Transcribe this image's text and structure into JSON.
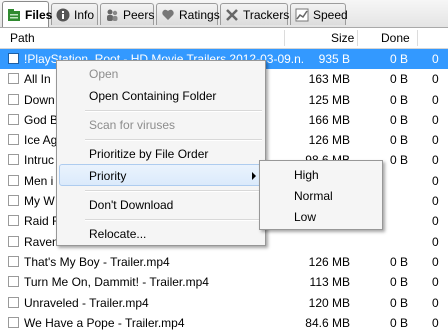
{
  "tabs": [
    {
      "label": "Files",
      "icon": "files-icon",
      "active": true
    },
    {
      "label": "Info",
      "icon": "info-icon"
    },
    {
      "label": "Peers",
      "icon": "peers-icon"
    },
    {
      "label": "Ratings",
      "icon": "ratings-icon"
    },
    {
      "label": "Trackers",
      "icon": "trackers-icon"
    },
    {
      "label": "Speed",
      "icon": "speed-icon"
    }
  ],
  "columns": {
    "path": "Path",
    "size": "Size",
    "done": "Done"
  },
  "rows": [
    {
      "path": "!PlayStation_Root - HD Movie Trailers 2012-03-09.n...",
      "size": "935 B",
      "done": "0 B",
      "extra": "0",
      "selected": true
    },
    {
      "path": "All In",
      "size": "163 MB",
      "done": "0 B",
      "extra": "0"
    },
    {
      "path": "Down",
      "size": "125 MB",
      "done": "0 B",
      "extra": "0"
    },
    {
      "path": "God B",
      "size": "166 MB",
      "done": "0 B",
      "extra": "0"
    },
    {
      "path": "Ice Ag",
      "size": "126 MB",
      "done": "0 B",
      "extra": "0"
    },
    {
      "path": "Intruc",
      "size": "98.6 MB",
      "done": "0 B",
      "extra": "0"
    },
    {
      "path": "Men i",
      "size": "",
      "done": "",
      "extra": "0"
    },
    {
      "path": "My W",
      "size": "",
      "done": "",
      "extra": "0"
    },
    {
      "path": "Raid F",
      "size": "",
      "done": "",
      "extra": "0"
    },
    {
      "path": "Raven",
      "size": "",
      "done": "",
      "extra": "0"
    },
    {
      "path": "That's My Boy - Trailer.mp4",
      "size": "126 MB",
      "done": "0 B",
      "extra": "0"
    },
    {
      "path": "Turn Me On, Dammit! - Trailer.mp4",
      "size": "113 MB",
      "done": "0 B",
      "extra": "0"
    },
    {
      "path": "Unraveled - Trailer.mp4",
      "size": "120 MB",
      "done": "0 B",
      "extra": "0"
    },
    {
      "path": "We Have a Pope - Trailer.mp4",
      "size": "84.6 MB",
      "done": "0 B",
      "extra": "0"
    }
  ],
  "context_menu": {
    "open": "Open",
    "open_folder": "Open Containing Folder",
    "scan": "Scan for viruses",
    "prioritize": "Prioritize by File Order",
    "priority": "Priority",
    "dont_download": "Don't Download",
    "relocate": "Relocate..."
  },
  "priority_submenu": {
    "high": "High",
    "normal": "Normal",
    "low": "Low"
  },
  "colors": {
    "selection": "#3399ff",
    "menu_bg": "#f5f5f5",
    "highlight_border": "#aeccef"
  }
}
